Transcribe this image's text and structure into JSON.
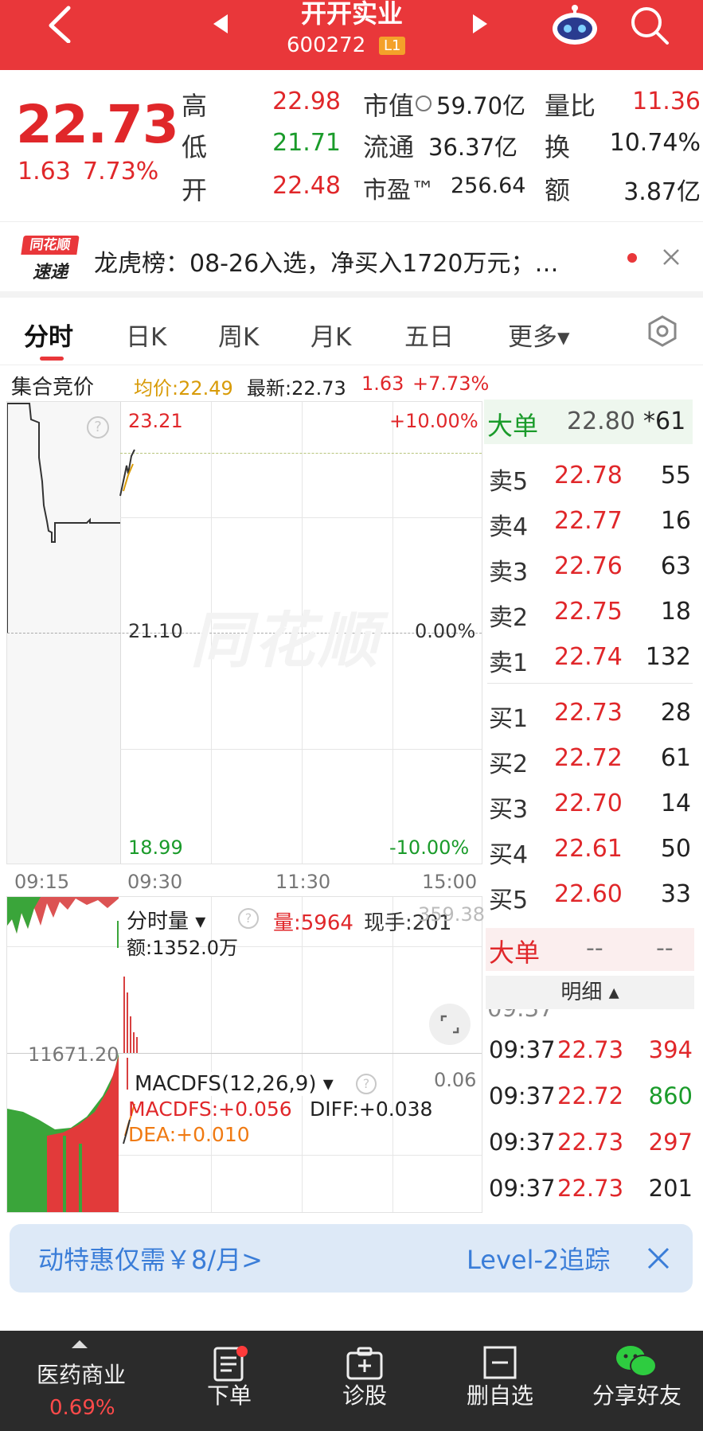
{
  "header": {
    "title": "开开实业",
    "code": "600272",
    "level_badge": "L1"
  },
  "quote": {
    "price": "22.73",
    "change": "1.63",
    "change_pct": "7.73%",
    "high_label": "高",
    "high": "22.98",
    "low_label": "低",
    "low": "21.71",
    "open_label": "开",
    "open": "22.48",
    "mktcap_label": "市值",
    "mktcap": "59.70亿",
    "float_label": "流通",
    "float": "36.37亿",
    "pe_label": "市盈™",
    "pe": "256.64",
    "vol_ratio_label": "量比",
    "vol_ratio": "11.36",
    "turnover_label": "换",
    "turnover": "10.74%",
    "amount_label": "额",
    "amount": "3.87亿"
  },
  "news": {
    "logo_top": "同花顺",
    "logo_bottom": "速递",
    "text": "龙虎榜：08-26入选，净买入1720万元；…"
  },
  "tabs": [
    {
      "label": "分时"
    },
    {
      "label": "日K"
    },
    {
      "label": "周K"
    },
    {
      "label": "月K"
    },
    {
      "label": "五日"
    },
    {
      "label": "更多▾"
    }
  ],
  "info_bar": {
    "auction": "集合竞价",
    "avg": "均价:22.49",
    "latest": "最新:22.73",
    "chg": "1.63",
    "pct": "+7.73%"
  },
  "chart": {
    "top_price": "23.21",
    "top_pct": "+10.00%",
    "mid_price": "21.10",
    "mid_pct": "0.00%",
    "bot_price": "18.99",
    "bot_pct": "-10.00%",
    "watermark": "同花顺",
    "time_labels": [
      "09:15",
      "09:30",
      "11:30",
      "15:00"
    ]
  },
  "volume": {
    "dropdown": "分时量 ▾",
    "qty": "量:5964",
    "now": "现手:201",
    "ghost": "359.38",
    "amount": "额:1352.0万",
    "side_value": "11671.20"
  },
  "macd": {
    "dropdown": "MACDFS(12,26,9) ▾",
    "right_value": "0.06",
    "macdfs": "MACDFS:+0.056",
    "diff": "DIFF:+0.038",
    "dea": "DEA:+0.010"
  },
  "orderbook": {
    "big_label": "大单",
    "big_price": "22.80",
    "big_vol": "*61",
    "asks": [
      {
        "label": "卖5",
        "price": "22.78",
        "vol": "55"
      },
      {
        "label": "卖4",
        "price": "22.77",
        "vol": "16"
      },
      {
        "label": "卖3",
        "price": "22.76",
        "vol": "63"
      },
      {
        "label": "卖2",
        "price": "22.75",
        "vol": "18"
      },
      {
        "label": "卖1",
        "price": "22.74",
        "vol": "132"
      }
    ],
    "bids": [
      {
        "label": "买1",
        "price": "22.73",
        "vol": "28"
      },
      {
        "label": "买2",
        "price": "22.72",
        "vol": "61"
      },
      {
        "label": "买3",
        "price": "22.70",
        "vol": "14"
      },
      {
        "label": "买4",
        "price": "22.61",
        "vol": "50"
      },
      {
        "label": "买5",
        "price": "22.60",
        "vol": "33"
      }
    ],
    "big2_label": "大单",
    "big2_a": "--",
    "big2_b": "--"
  },
  "detail": {
    "header": "明细 ▴",
    "rows": [
      {
        "time": "09:37",
        "price": "22.73",
        "vol": "394",
        "color": "#e0272a"
      },
      {
        "time": "09:37",
        "price": "22.72",
        "vol": "860",
        "color": "#1a9b2a"
      },
      {
        "time": "09:37",
        "price": "22.73",
        "vol": "297",
        "color": "#e0272a"
      },
      {
        "time": "09:37",
        "price": "22.73",
        "vol": "201",
        "color": "#222222"
      }
    ]
  },
  "promo": {
    "left": "动特惠仅需￥8/月>",
    "right": "Level-2追踪"
  },
  "bottom_bar": {
    "sector": "医药商业",
    "sector_pct": "0.69%",
    "order": "下单",
    "diagnose": "诊股",
    "remove": "删自选",
    "share": "分享好友"
  },
  "colors": {
    "brand_red": "#e9373a",
    "up": "#e0272a",
    "down": "#1a9b2a",
    "avg_line": "#d89b08"
  }
}
